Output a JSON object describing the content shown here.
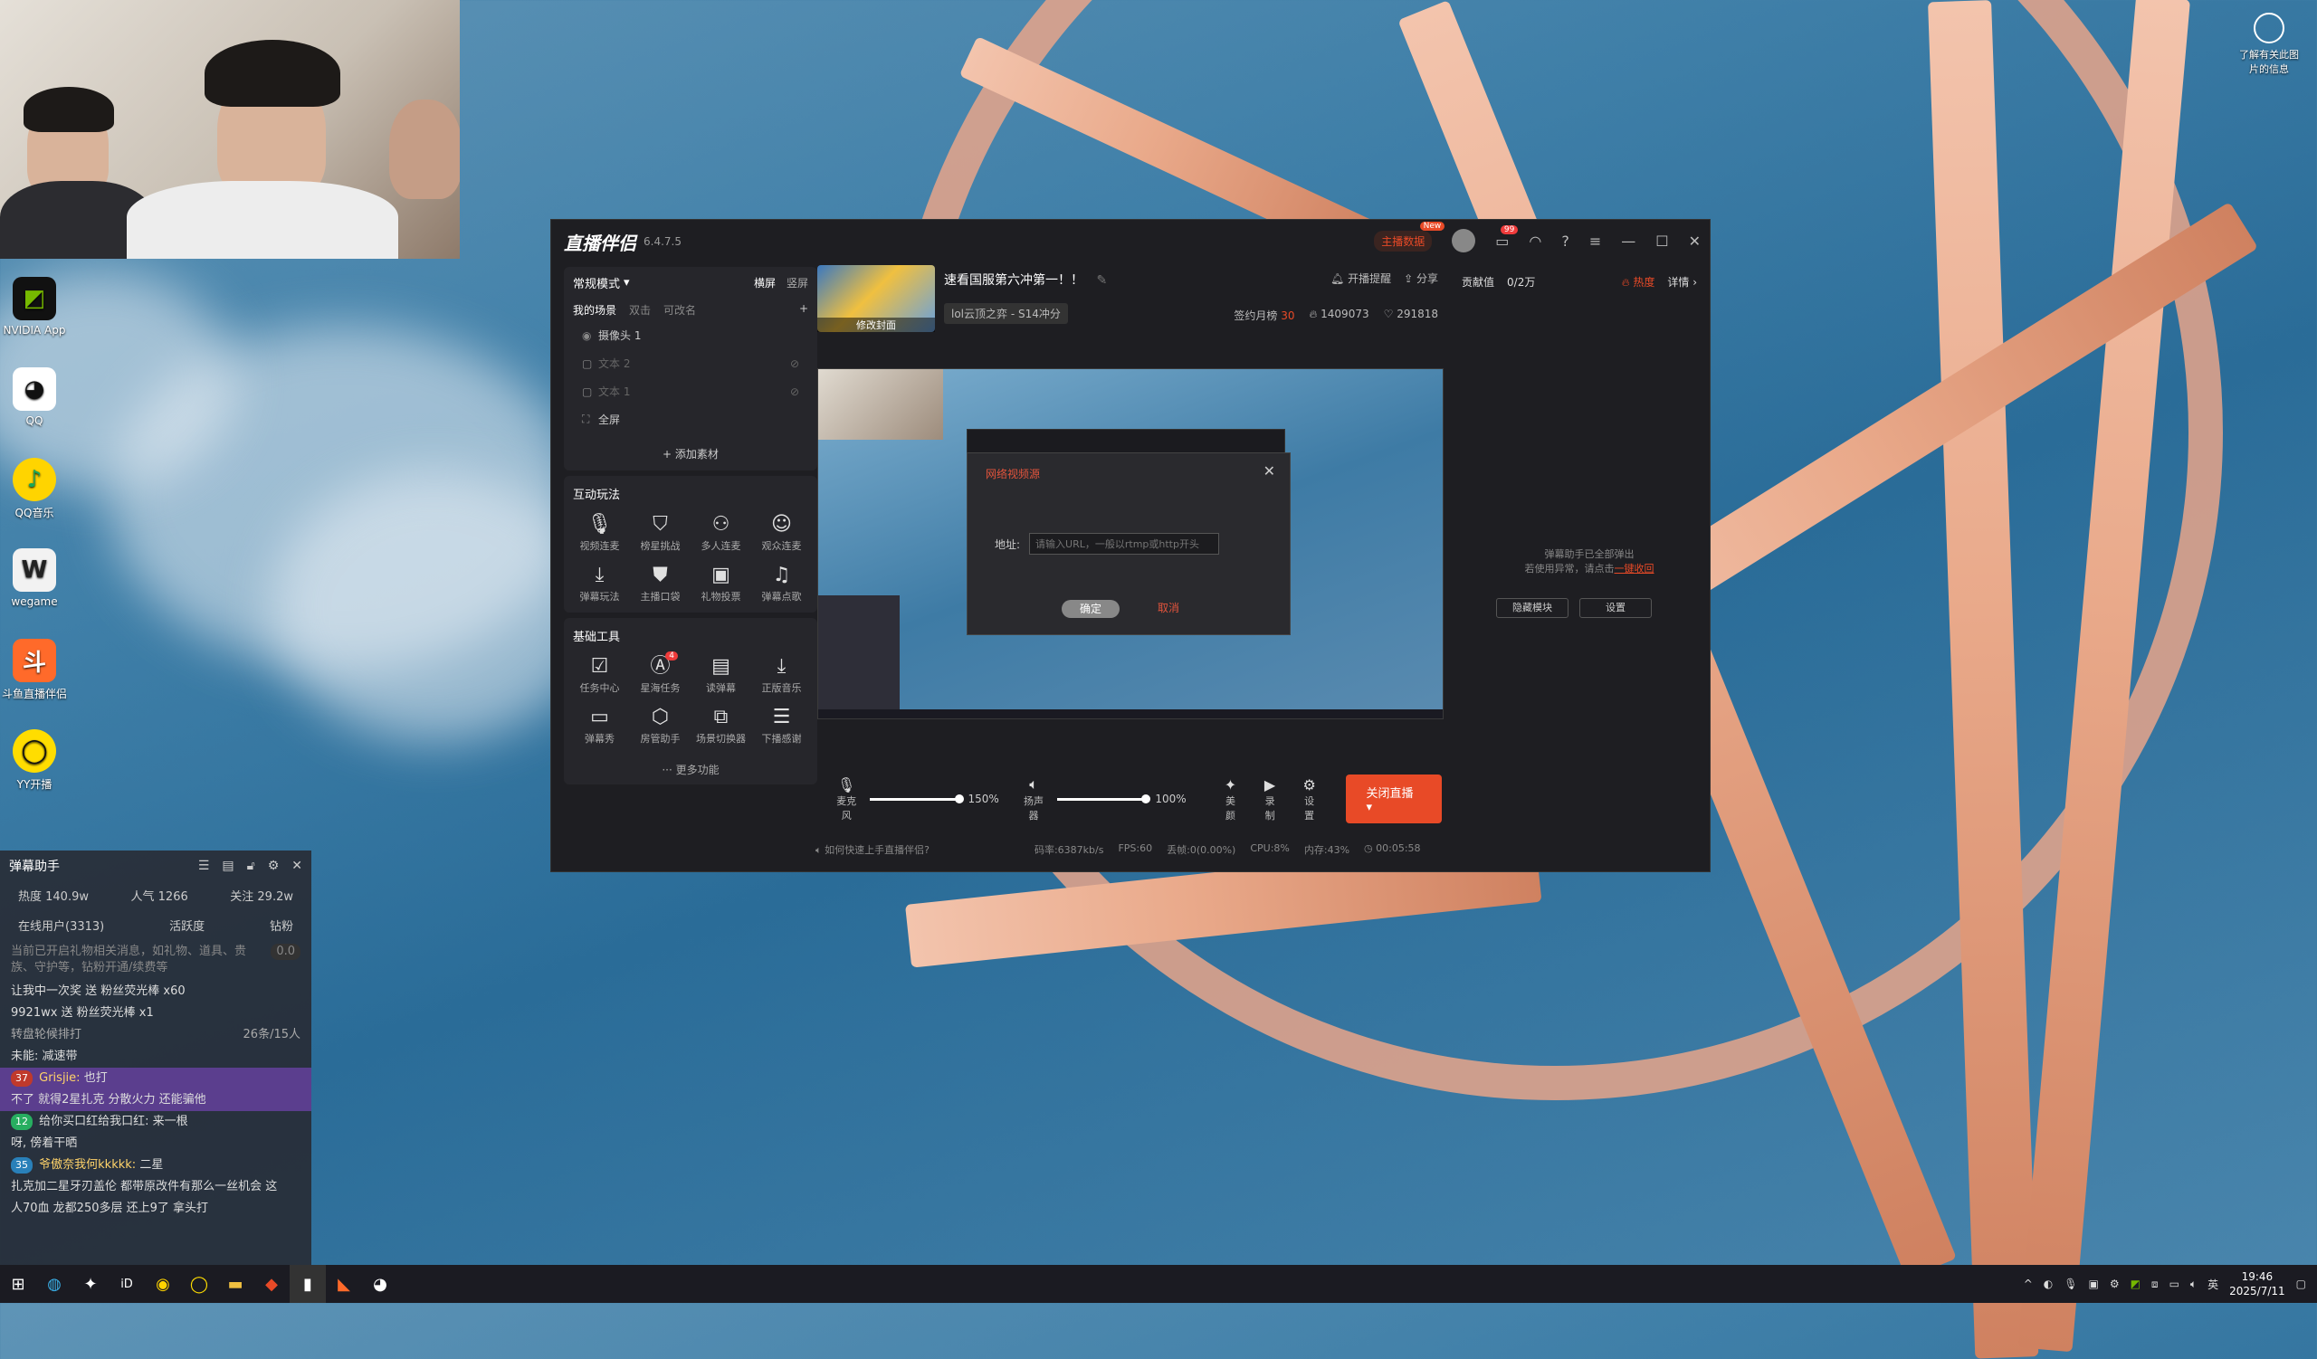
{
  "desktop": {
    "icons": [
      "NVIDIA App",
      "QQ",
      "QQ音乐",
      "wegame",
      "斗鱼直播伴侣",
      "YY开播"
    ],
    "corner_text": "了解有关此图片的信息"
  },
  "app": {
    "name": "直播伴侣",
    "version": "6.4.7.5",
    "host_data": "主播数据",
    "new_badge": "New",
    "msg_count": "99",
    "mode": "常规模式",
    "orient_landscape": "横屏",
    "orient_portrait": "竖屏",
    "scene_tabs": [
      "我的场景",
      "双击",
      "可改名"
    ],
    "sources": [
      "摄像头 1",
      "文本 2",
      "文本 1",
      "全屏"
    ],
    "add_source": "添加素材",
    "interact_title": "互动玩法",
    "interact_tools": [
      "视频连麦",
      "榜星挑战",
      "多人连麦",
      "观众连麦",
      "弹幕玩法",
      "主播口袋",
      "礼物投票",
      "弹幕点歌"
    ],
    "basic_title": "基础工具",
    "basic_tools": [
      "任务中心",
      "星海任务",
      "读弹幕",
      "正版音乐",
      "弹幕秀",
      "房管助手",
      "场景切换器",
      "下播感谢"
    ],
    "ad_badge": "4",
    "more": "更多功能",
    "cover_label": "修改封面",
    "stream_title": "速看国服第六冲第一！！",
    "category": "lol云顶之弈 - S14冲分",
    "remind": "开播提醒",
    "share": "分享",
    "sign_label": "签约月榜",
    "sign_value": "30",
    "heat": "1409073",
    "fans": "291818",
    "contrib_label": "贡献值",
    "contrib_value": "0/2万",
    "hot_label": "热度",
    "detail": "详情",
    "notice_line1": "弹幕助手已全部弹出",
    "notice_line2": "若使用异常，请点击",
    "notice_link": "一键收回",
    "hide_module": "隐藏模块",
    "settings": "设置",
    "mic": "麦克风",
    "mic_pct": "150%",
    "speaker": "扬声器",
    "speaker_pct": "100%",
    "beauty": "美颜",
    "record": "录制",
    "ctl_settings": "设置",
    "stop_live": "关闭直播",
    "help": "如何快速上手直播伴侣?",
    "bitrate": "码率:6387kb/s",
    "fps": "FPS:60",
    "drop": "丢帧:0(0.00%)",
    "cpu": "CPU:8%",
    "mem": "内存:43%",
    "duration": "00:05:58"
  },
  "dialog": {
    "title": "网络视频源",
    "addr_label": "地址:",
    "placeholder": "请输入URL，一般以rtmp或http开头",
    "ok": "确定",
    "cancel": "取消"
  },
  "danmu": {
    "title": "弹幕助手",
    "heat": "热度 140.9w",
    "popularity": "人气 1266",
    "follow": "关注 29.2w",
    "tab_online": "在线用户(3313)",
    "tab_active": "活跃度",
    "tab_diamond": "钻粉",
    "coin": "0.0",
    "tip": "当前已开启礼物相关消息，如礼物、道具、贵族、守护等，钻粉开通/续费等",
    "gift1": "让我中一次奖 送 粉丝荧光棒 x60",
    "gift2": "9921wx 送 粉丝荧光棒 x1",
    "line_queue": "转盘轮候排打",
    "queue_count": "26条/15人",
    "line_reduce": "未能: 减速带",
    "msg1_user": "Grisjie:",
    "msg1_text": "也打",
    "msg1_cont": "不了 就得2星扎克 分散火力 还能骗他",
    "msg2": "给你买口红给我口红: 来一根",
    "msg2_cont": "呀, 傍着干晒",
    "msg3_user": "爷傲奈我何kkkkk:",
    "msg3_text": "二星",
    "msg3_cont": "扎克加二星牙刃盖伦 都带原改件有那么一丝机会 这",
    "msg4": "人70血 龙都250多层 还上9了 拿头打"
  },
  "taskbar": {
    "lang": "英",
    "time": "19:46",
    "date": "2025/7/11"
  }
}
